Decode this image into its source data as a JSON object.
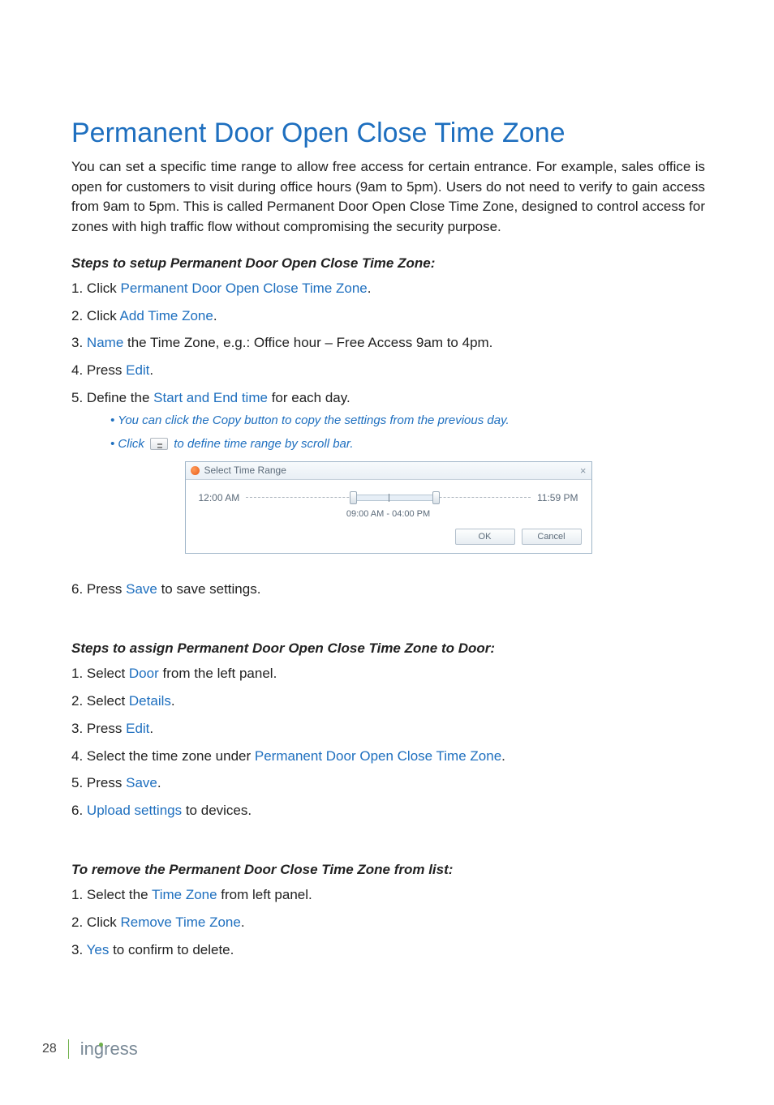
{
  "title": "Permanent Door Open Close Time Zone",
  "intro": "You can set a specific time range to allow free access for certain entrance. For example, sales office is open for customers to visit during office hours (9am to 5pm). Users do not need to verify to gain access from 9am to 5pm. This is called Permanent Door Open Close Time Zone, designed to control access for zones with high traffic flow without compromising the security purpose.",
  "section1": {
    "heading": "Steps to setup Permanent Door Open Close Time Zone:",
    "step1_a": "Click ",
    "step1_kw": "Permanent Door Open Close Time Zone",
    "step1_b": ".",
    "step2_a": "Click ",
    "step2_kw": "Add Time Zone",
    "step2_b": ".",
    "step3_kw": "Name",
    "step3_b": " the Time Zone, e.g.: Office hour – Free Access 9am to 4pm.",
    "step4_a": "Press ",
    "step4_kw": "Edit",
    "step4_b": ".",
    "step5_a": "Define the ",
    "step5_kw": "Start and End time",
    "step5_b": " for each day.",
    "bullet1": "You can click the Copy button to copy the settings from the previous day.",
    "bullet2_a": "Click ",
    "bullet2_b": " to define time range by scroll bar.",
    "step6_a": "Press ",
    "step6_kw": "Save",
    "step6_b": " to save settings."
  },
  "dialog": {
    "title": "Select Time Range",
    "leftLabel": "12:00 AM",
    "rightLabel": "11:59 PM",
    "readout": "09:00 AM   -   04:00 PM",
    "ok": "OK",
    "cancel": "Cancel",
    "fillLeftPct": 37.5,
    "fillWidthPct": 29.2,
    "centerPct": 50
  },
  "section2": {
    "heading": "Steps to assign Permanent Door Open Close Time Zone to Door:",
    "step1_a": "Select ",
    "step1_kw": "Door",
    "step1_b": " from the left panel.",
    "step2_a": "Select ",
    "step2_kw": "Details",
    "step2_b": ".",
    "step3_a": "Press ",
    "step3_kw": "Edit",
    "step3_b": ".",
    "step4_a": "Select the time zone under ",
    "step4_kw": "Permanent Door Open Close Time Zone",
    "step4_b": ".",
    "step5_a": "Press ",
    "step5_kw": "Save",
    "step5_b": ".",
    "step6_kw": "Upload settings",
    "step6_b": " to devices."
  },
  "section3": {
    "heading": "To remove the Permanent Door Close Time Zone from list:",
    "step1_a": "Select the ",
    "step1_kw": "Time Zone",
    "step1_b": " from left panel.",
    "step2_a": "Click ",
    "step2_kw": "Remove Time Zone",
    "step2_b": ".",
    "step3_kw": "Yes",
    "step3_b": " to confirm to delete."
  },
  "footer": {
    "page": "28",
    "brand_a": "in",
    "brand_b": "ress"
  }
}
